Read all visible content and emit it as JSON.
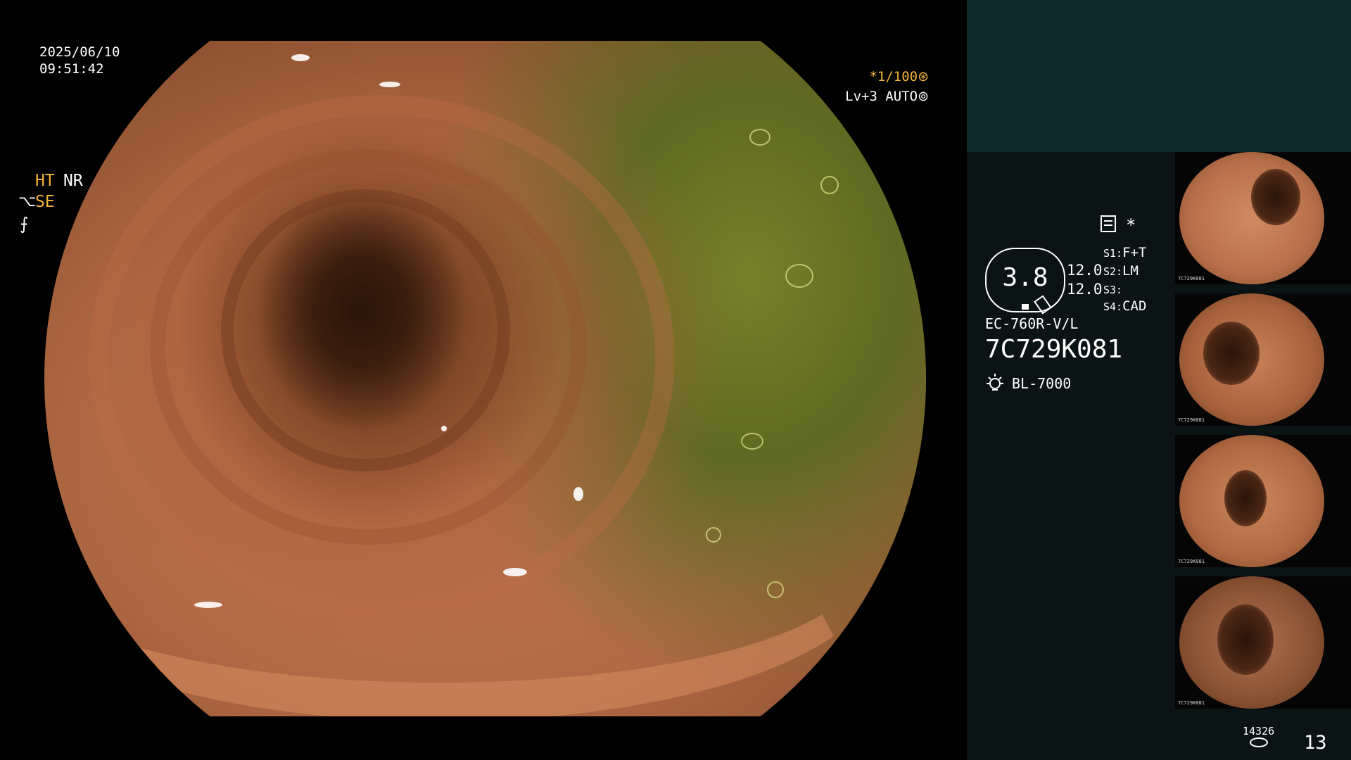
{
  "overlay": {
    "date": "2025/06/10",
    "time": "09:51:42",
    "shutter": "*1/100",
    "level": "Lv+3 AUTO"
  },
  "panel": {
    "mode_ht": "HT",
    "mode_nr": "NR",
    "mode_se": "SE",
    "star": "*",
    "gauge_value": "3.8",
    "gauge_right_1": "12.0",
    "gauge_right_2": "12.0",
    "switches": [
      {
        "key": "S1:",
        "value": "F+T"
      },
      {
        "key": "S2:",
        "value": "LM"
      },
      {
        "key": "S3:",
        "value": ""
      },
      {
        "key": "S4:",
        "value": "CAD"
      }
    ],
    "scope_model": "EC-760R-V/L",
    "scope_serial": "7C729K081",
    "light_source": "BL-7000"
  },
  "thumbnails": [
    {
      "label": "7C729K081"
    },
    {
      "label": "7C729K081"
    },
    {
      "label": "7C729K081"
    },
    {
      "label": "7C729K081"
    }
  ],
  "counter": {
    "total": "14326",
    "captures": "13"
  },
  "icons": [
    "shutter-icon",
    "auto-iris-icon",
    "se-icon",
    "f-icon",
    "memory-icon",
    "light-source-icon",
    "storage-icon"
  ]
}
